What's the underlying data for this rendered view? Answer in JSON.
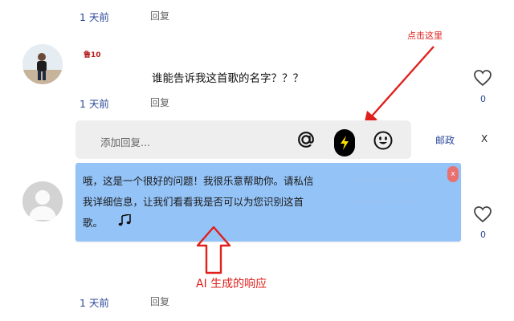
{
  "thread": [
    {
      "time": "1 天前",
      "reply_label": "回复"
    },
    {
      "time": "1 天前",
      "reply_label": "回复"
    },
    {
      "time": "1 天前",
      "reply_label": "回复"
    }
  ],
  "comment": {
    "username": "鲁10",
    "text": "谁能告诉我这首歌的名字？？？",
    "like_count": "0"
  },
  "reply_box": {
    "placeholder": "添加回复...",
    "at_icon": "at-sign-icon",
    "ai_icon": "lightning-bolt-icon",
    "emoji_icon": "smiley-icon",
    "post_label": "邮政",
    "close_label": "X"
  },
  "ai_response": {
    "line1": "哦，这是一个很好的问题！我很乐意帮助你。请私信",
    "line2": "我详细信息，让我们看看我是否可以为您识别这首",
    "line3": "歌。",
    "music_icon": "music-notes-icon",
    "close_icon": "close-icon",
    "like_count": "0"
  },
  "annotations": {
    "click_here": "点击这里",
    "ai_generated": "AI 生成的响应"
  },
  "colors": {
    "accent_red": "#e0201c",
    "ai_box": "#94c3f7",
    "link_blue": "#2c4a9a"
  }
}
